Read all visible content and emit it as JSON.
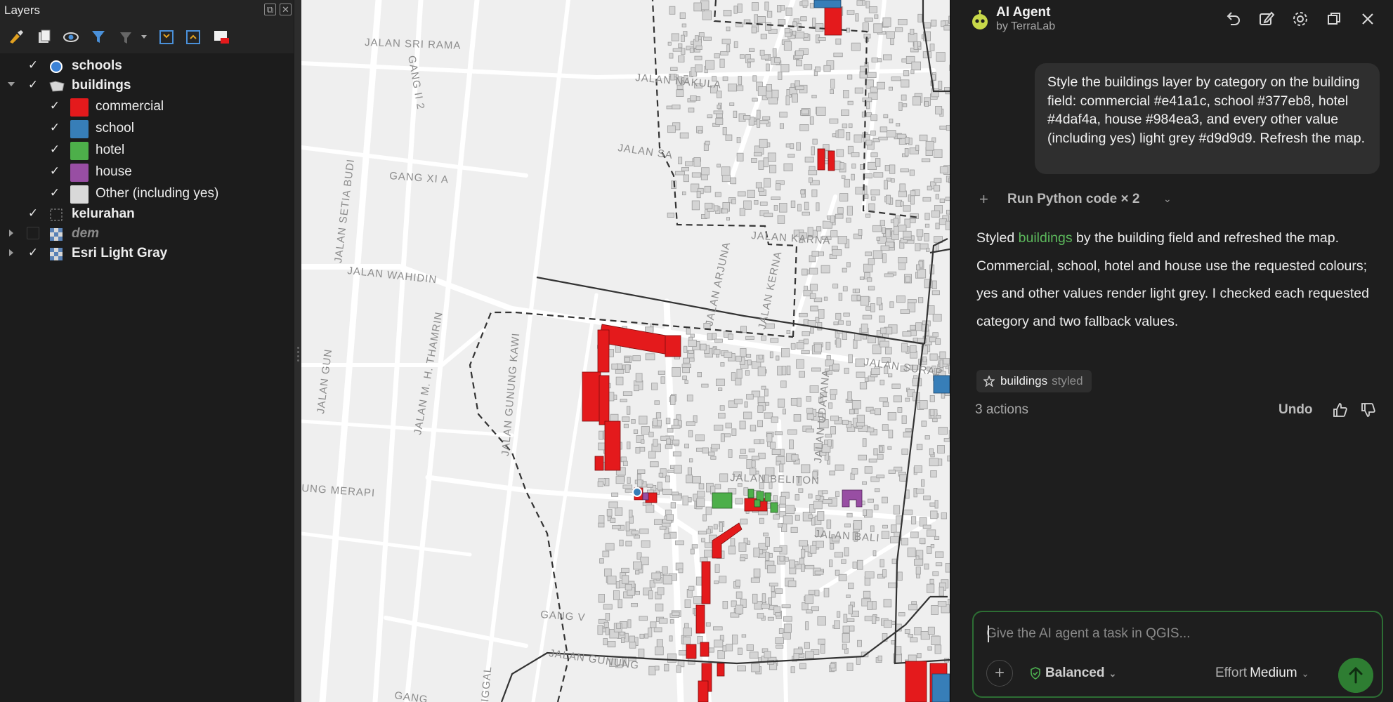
{
  "layers_panel": {
    "title": "Layers",
    "tree": [
      {
        "label": "schools",
        "checked": true,
        "bold": true,
        "icon": "point-icon"
      },
      {
        "label": "buildings",
        "checked": true,
        "bold": true,
        "expanded": true,
        "icon": "polygon-icon"
      },
      {
        "label": "commercial",
        "checked": true,
        "color": "#e41a1c"
      },
      {
        "label": "school",
        "checked": true,
        "color": "#377eb8"
      },
      {
        "label": "hotel",
        "checked": true,
        "color": "#4daf4a"
      },
      {
        "label": "house",
        "checked": true,
        "color": "#984ea3"
      },
      {
        "label": "Other (including yes)",
        "checked": true,
        "color": "#d9d9d9"
      },
      {
        "label": "kelurahan",
        "checked": true,
        "bold": true,
        "icon": "dashed-polygon-icon"
      },
      {
        "label": "dem",
        "checked": false,
        "icon": "raster-icon"
      },
      {
        "label": "Esri Light Gray",
        "checked": true,
        "bold": true,
        "icon": "raster-icon"
      }
    ]
  },
  "map": {
    "streets": [
      "JALAN SRI RAMA",
      "GANG II 2",
      "JALAN NAKULA",
      "JALAN SA",
      "GANG XI A",
      "JALAN SETIA BUDI",
      "JALAN WAHIDIN",
      "JALAN ARJUNA",
      "JALAN KARNA",
      "JALAN KERNA",
      "JALAN M. H. THAMRIN",
      "JALAN GUNUNG KAWI",
      "JALAN UDAYANA",
      "JALAN SURAP",
      "JALAN BELITON",
      "UNG MERAPI",
      "JALAN BALI",
      "GANG V",
      "JALAN GUNUNG",
      "JALAN GUN",
      "GANG",
      "IGGAL"
    ]
  },
  "ai_panel": {
    "name": "AI Agent",
    "by": "by TerraLab",
    "user_message": "Style the buildings layer by category on the building field: commercial #e41a1c, school #377eb8, hotel #4daf4a, house #984ea3, and every other value (including yes) light grey #d9d9d9. Refresh the map.",
    "tool_call": "Run Python code × 2",
    "reply_prefix": "Styled ",
    "reply_layer": "buildings",
    "reply_rest": " by the building field and refreshed the map. Commercial, school, hotel and house use the requested colours; yes and other values render light grey. I checked each requested category and two fallback values.",
    "chip_name": "buildings",
    "chip_status": "styled",
    "actions_count": "3 actions",
    "undo": "Undo",
    "input_placeholder": "Give the AI agent a task in QGIS...",
    "mode": "Balanced",
    "effort_label": "Effort",
    "effort_value": "Medium"
  }
}
